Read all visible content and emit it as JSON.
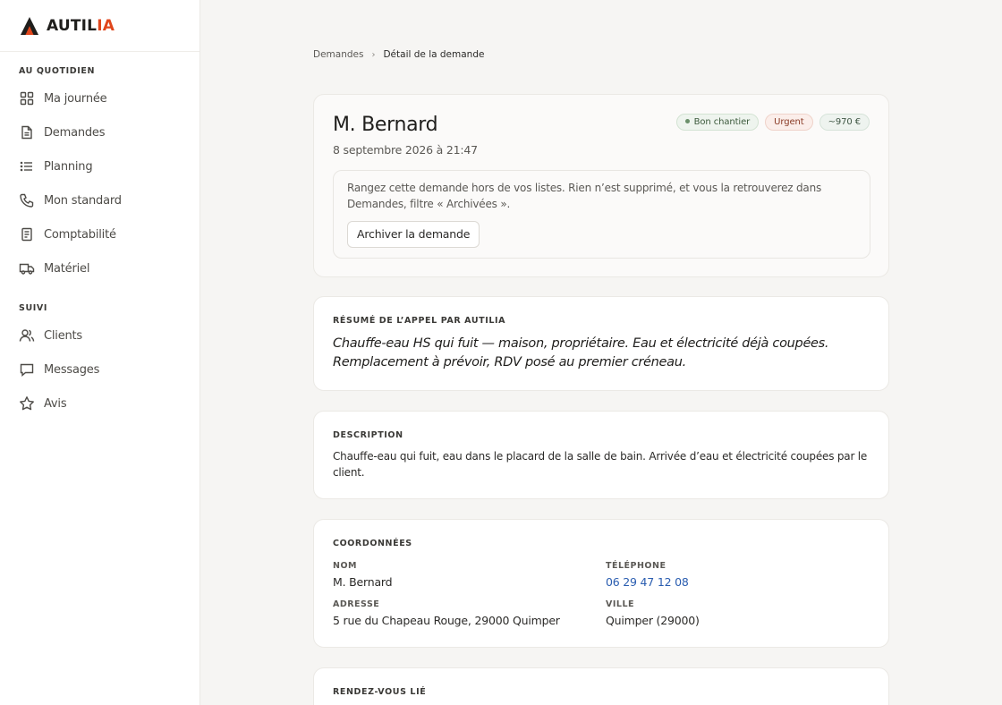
{
  "brand": {
    "name_part1": "AUTIL",
    "name_part2": "IA",
    "accent": "#e0461c"
  },
  "sidebar": {
    "sections": [
      {
        "title": "AU QUOTIDIEN",
        "items": [
          {
            "label": "Ma journée",
            "icon": "grid-icon"
          },
          {
            "label": "Demandes",
            "icon": "document-icon"
          },
          {
            "label": "Planning",
            "icon": "list-icon"
          },
          {
            "label": "Mon standard",
            "icon": "phone-icon"
          },
          {
            "label": "Comptabilité",
            "icon": "receipt-icon"
          },
          {
            "label": "Matériel",
            "icon": "truck-icon"
          }
        ]
      },
      {
        "title": "SUIVI",
        "items": [
          {
            "label": "Clients",
            "icon": "users-icon"
          },
          {
            "label": "Messages",
            "icon": "message-icon"
          },
          {
            "label": "Avis",
            "icon": "star-icon"
          }
        ]
      }
    ]
  },
  "breadcrumb": {
    "parent": "Demandes",
    "current": "Détail de la demande"
  },
  "request": {
    "client_name": "M. Bernard",
    "date": "8 septembre 2026 à 21:47",
    "badges": {
      "quality": "Bon chantier",
      "urgency": "Urgent",
      "amount": "~970 €"
    },
    "archive": {
      "text": "Rangez cette demande hors de vos listes. Rien n’est supprimé, et vous la retrouverez dans Demandes, filtre « Archivées ».",
      "button": "Archiver la demande"
    }
  },
  "summary": {
    "label": "RÉSUMÉ DE L’APPEL PAR AUTILIA",
    "text": "Chauffe-eau HS qui fuit — maison, propriétaire. Eau et électricité déjà coupées. Remplacement à prévoir, RDV posé au premier créneau."
  },
  "description": {
    "label": "DESCRIPTION",
    "text": "Chauffe-eau qui fuit, eau dans le placard de la salle de bain. Arrivée d’eau et électricité coupées par le client."
  },
  "coordinates": {
    "label": "COORDONNÉES",
    "name_label": "NOM",
    "name": "M. Bernard",
    "phone_label": "TÉLÉPHONE",
    "phone": "06 29 47 12 08",
    "address_label": "ADRESSE",
    "address": "5 rue du Chapeau Rouge, 29000 Quimper",
    "city_label": "VILLE",
    "city": "Quimper (29000)"
  },
  "appointment": {
    "label": "RENDEZ-VOUS LIÉ"
  }
}
